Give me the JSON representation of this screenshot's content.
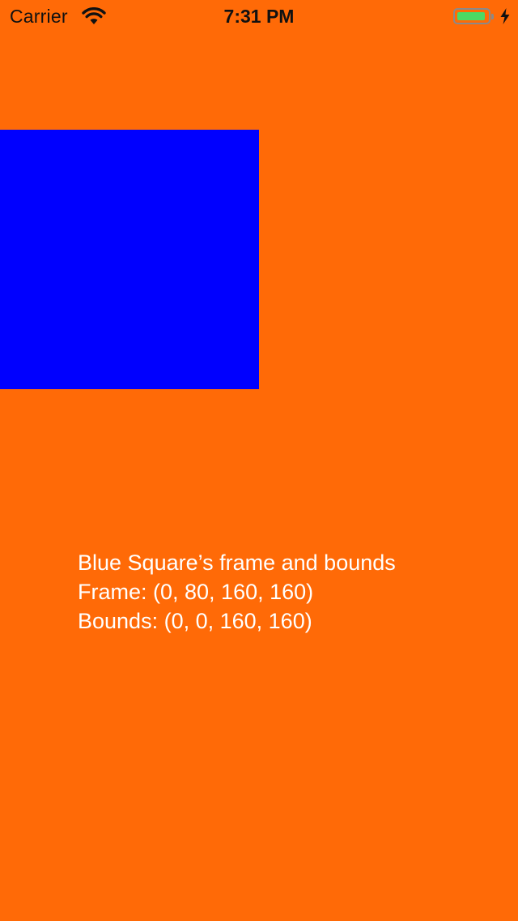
{
  "status_bar": {
    "carrier": "Carrier",
    "time": "7:31 PM",
    "wifi_icon": "wifi-icon",
    "battery_icon": "battery-icon",
    "charging_icon": "bolt-icon",
    "battery_level": 0.9,
    "battery_color": "#4cd964"
  },
  "colors": {
    "background": "#ff6a07",
    "square": "#0000ff",
    "text": "#ffffff"
  },
  "info": {
    "title": "Blue Square’s frame and bounds",
    "frame": "Frame: (0, 80, 160, 160)",
    "bounds": "Bounds: (0, 0, 160, 160)"
  }
}
